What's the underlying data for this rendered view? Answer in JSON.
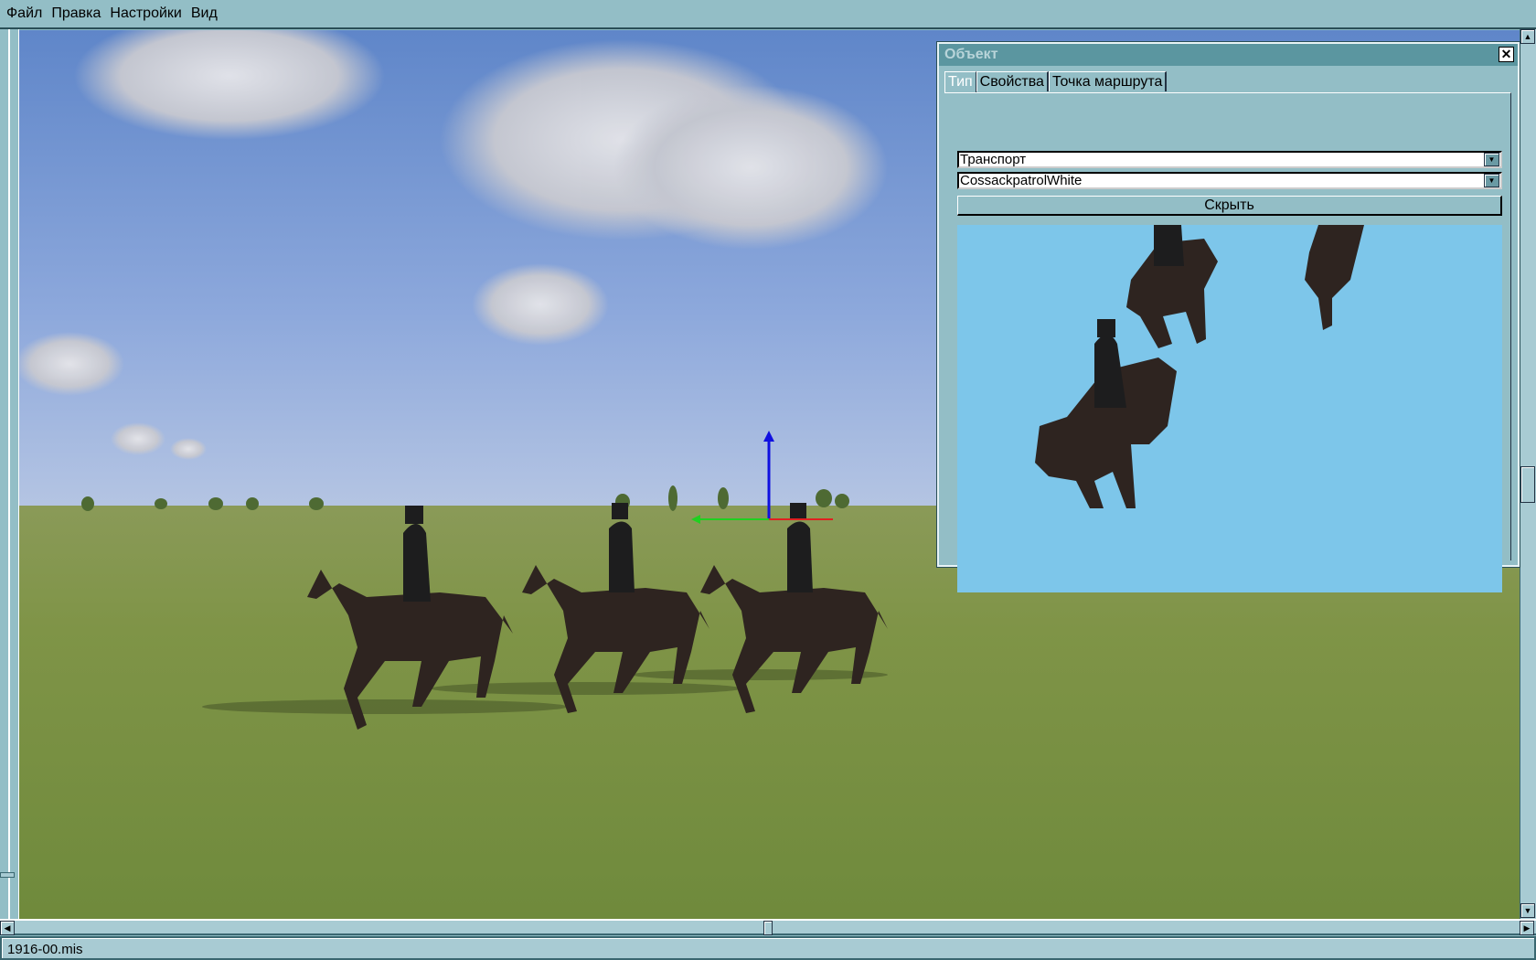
{
  "menu": {
    "items": [
      "Файл",
      "Правка",
      "Настройки",
      "Вид"
    ]
  },
  "dialog": {
    "title": "Объект",
    "close_icon": "close-icon",
    "tabs": [
      "Тип",
      "Свойства",
      "Точка маршрута"
    ],
    "active_tab": "Тип",
    "category_select": "Транспорт",
    "object_select": "CossackpatrolWhite",
    "hide_button": "Скрыть"
  },
  "status": {
    "filename": "1916-00.mis"
  },
  "colors": {
    "chrome": "#93bec6",
    "title_bar": "#5b96a0",
    "preview_bg": "#7dc6ea"
  }
}
